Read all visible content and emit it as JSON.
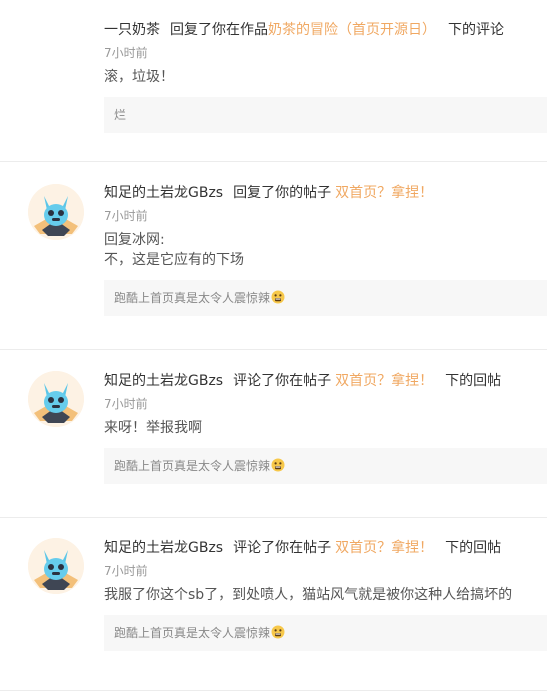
{
  "notifications": [
    {
      "user": "一只奶茶",
      "action": "回复了你在作品",
      "target": "奶茶的冒险（首页开源日）",
      "suffix": "下的评论",
      "time": "7小时前",
      "body": [
        "滚，垃圾！"
      ],
      "quote": "烂",
      "has_avatar": false
    },
    {
      "user": "知足的土岩龙GBzs",
      "action": "回复了你的帖子",
      "target": "双首页？拿捏！",
      "suffix": "",
      "time": "7小时前",
      "body": [
        "回复冰网:",
        "不，这是它应有的下场"
      ],
      "quote": "跑酷上首页真是太令人震惊辣",
      "has_avatar": true
    },
    {
      "user": "知足的土岩龙GBzs",
      "action": "评论了你在帖子",
      "target": "双首页？拿捏！",
      "suffix": "下的回帖",
      "time": "7小时前",
      "body": [
        "来呀！举报我啊"
      ],
      "quote": "跑酷上首页真是太令人震惊辣",
      "has_avatar": true
    },
    {
      "user": "知足的土岩龙GBzs",
      "action": "评论了你在帖子",
      "target": "双首页？拿捏！",
      "suffix": "下的回帖",
      "time": "7小时前",
      "body": [
        "我服了你这个sb了，到处喷人，猫站风气就是被你这种人给搞坏的"
      ],
      "quote": "跑酷上首页真是太令人震惊辣",
      "has_avatar": true
    }
  ],
  "icons": {
    "avatar": "blue-dragon-avatar-icon",
    "quote_emoji": "shocked-face-emoji-icon"
  },
  "colors": {
    "link": "#f0a862",
    "time": "#999999",
    "quote_bg": "#f7f7f7"
  }
}
